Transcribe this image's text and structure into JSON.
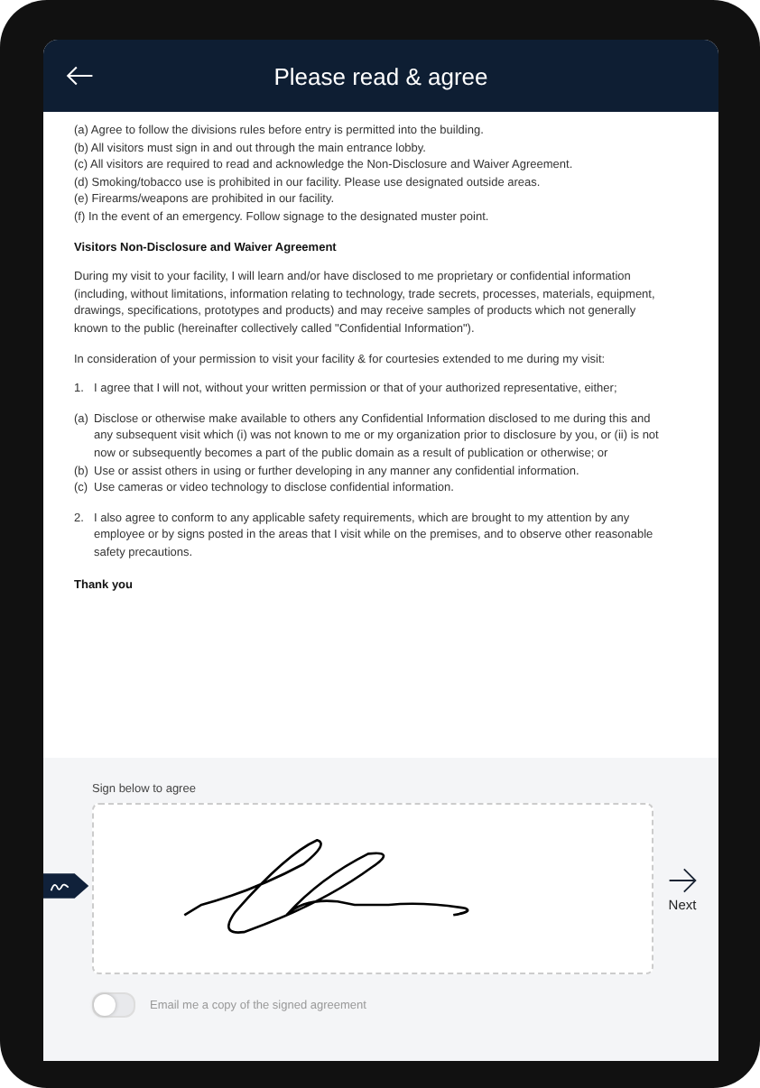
{
  "header": {
    "title": "Please read & agree"
  },
  "rules": [
    "(a) Agree to follow the divisions rules before entry is permitted into the building.",
    "(b) All visitors must sign in and out through the main entrance lobby.",
    "(c) All visitors are required to read and acknowledge the Non-Disclosure and Waiver Agreement.",
    "(d) Smoking/tobacco use is prohibited in our facility. Please use designated outside areas.",
    "(e) Firearms/weapons are prohibited in our facility.",
    "(f) In the event of an emergency. Follow signage to the designated muster point."
  ],
  "agreement": {
    "heading": "Visitors Non-Disclosure and Waiver Agreement",
    "paragraphs": [
      "During my visit to your facility, I will learn and/or have disclosed to me proprietary or confidential information (including, without limitations, information relating to technology, trade secrets, processes, materials, equipment, drawings, specifications, prototypes and products) and may receive samples of products which not generally known to the public (hereinafter collectively called \"Confidential Information\").",
      "In consideration of your permission to visit your facility & for courtesies extended to me during my visit:"
    ],
    "clauses": [
      {
        "marker": "1.",
        "text": "I agree that I will not, without your written permission or that of your authorized representative, either;"
      },
      {
        "marker": "(a)",
        "text": "Disclose or otherwise make available to others any Confidential Information disclosed to me during this and any subsequent visit which (i) was not known to me or my organization prior to disclosure by you, or (ii) is not now or subsequently becomes a part of the public domain as a result of publication or otherwise; or"
      },
      {
        "marker": "(b)",
        "text": "Use or assist others in using or further developing in any manner any confidential information."
      },
      {
        "marker": "(c)",
        "text": "Use cameras or video technology to disclose confidential information."
      },
      {
        "marker": "2.",
        "text": "I also agree to conform to any applicable safety requirements, which are brought to my attention by any employee or by signs posted in the areas that I visit while on the premises, and to observe other reasonable safety precautions."
      }
    ],
    "closing": "Thank you"
  },
  "signature": {
    "label": "Sign below to agree",
    "signed": true
  },
  "next": {
    "label": "Next"
  },
  "email_copy": {
    "label": "Email me a copy of the signed agreement",
    "on": false
  }
}
